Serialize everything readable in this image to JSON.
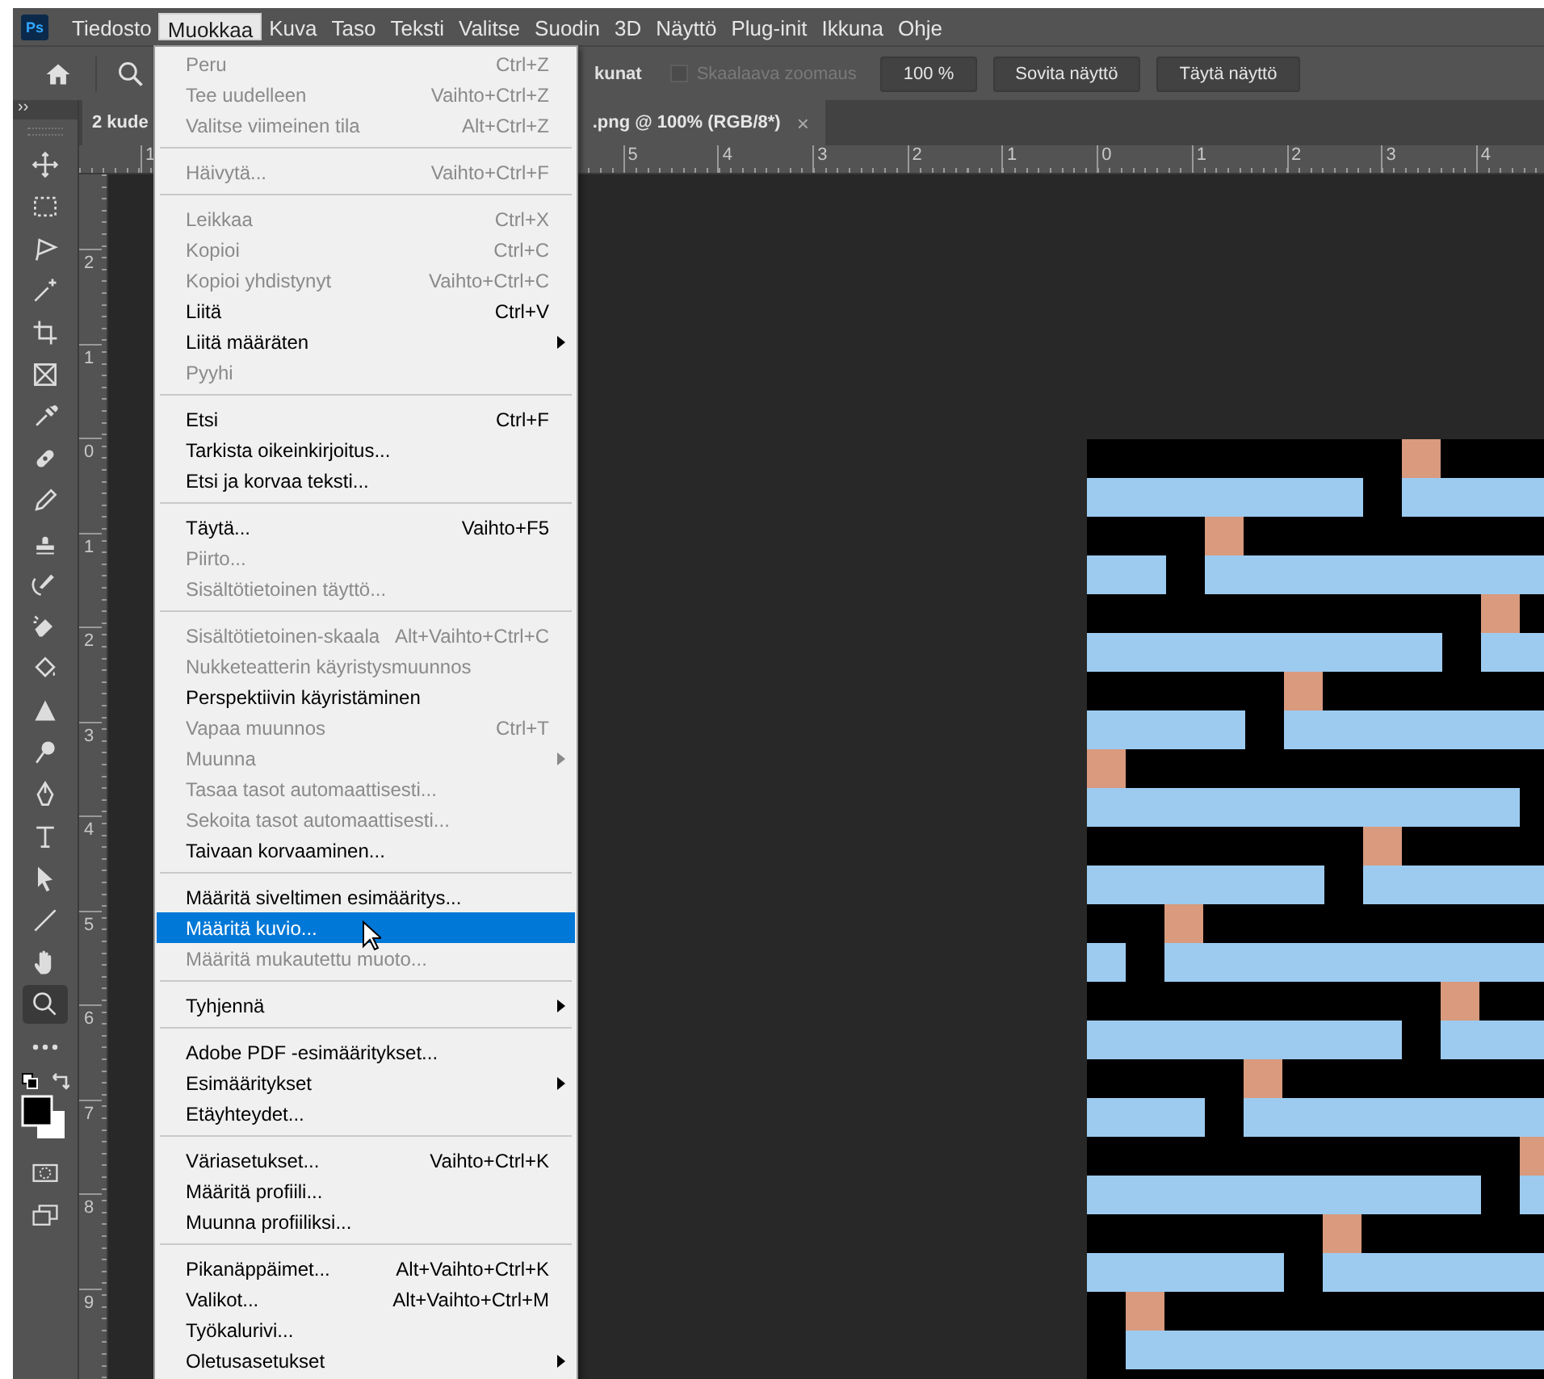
{
  "app_icon": "Ps",
  "menubar": [
    {
      "label": "Tiedosto",
      "selected": false
    },
    {
      "label": "Muokkaa",
      "selected": true
    },
    {
      "label": "Kuva",
      "selected": false
    },
    {
      "label": "Taso",
      "selected": false
    },
    {
      "label": "Teksti",
      "selected": false
    },
    {
      "label": "Valitse",
      "selected": false
    },
    {
      "label": "Suodin",
      "selected": false
    },
    {
      "label": "3D",
      "selected": false
    },
    {
      "label": "Näyttö",
      "selected": false
    },
    {
      "label": "Plug-init",
      "selected": false
    },
    {
      "label": "Ikkuna",
      "selected": false
    },
    {
      "label": "Ohje",
      "selected": false
    }
  ],
  "options_bar": {
    "partial_label": "kunat",
    "checkbox": {
      "label": "Skaalaava zoomaus",
      "checked": false,
      "disabled": true
    },
    "buttons": [
      "100 %",
      "Sovita näyttö",
      "Täytä näyttö"
    ]
  },
  "document_tab": {
    "title_start": "2 kude",
    "title_end": ".png @ 100% (RGB/8*)",
    "close": "×"
  },
  "tool_panel": {
    "collapse": "››",
    "tools": [
      {
        "kind": "move",
        "selected": false
      },
      {
        "kind": "marquee",
        "selected": false
      },
      {
        "kind": "lasso",
        "selected": false
      },
      {
        "kind": "wand",
        "selected": false
      },
      {
        "kind": "crop",
        "selected": false
      },
      {
        "kind": "frame",
        "selected": false
      },
      {
        "kind": "eyedropper",
        "selected": false
      },
      {
        "kind": "bandage",
        "selected": false
      },
      {
        "kind": "pencil",
        "selected": false
      },
      {
        "kind": "stamp",
        "selected": false
      },
      {
        "kind": "history",
        "selected": false
      },
      {
        "kind": "eraser",
        "selected": false
      },
      {
        "kind": "bucket",
        "selected": false
      },
      {
        "kind": "triangle",
        "selected": false
      },
      {
        "kind": "dodge",
        "selected": false
      },
      {
        "kind": "pen",
        "selected": false
      },
      {
        "kind": "text",
        "selected": false
      },
      {
        "kind": "arrow",
        "selected": false
      },
      {
        "kind": "line",
        "selected": false
      },
      {
        "kind": "hand",
        "selected": false
      },
      {
        "kind": "zoom",
        "selected": true
      },
      {
        "kind": "more",
        "selected": false
      }
    ]
  },
  "horizontal_ruler": {
    "labels_before_menu": [
      "1"
    ],
    "labels_after_menu": [
      "5",
      "4",
      "3",
      "2",
      "1",
      "0",
      "1",
      "2",
      "3",
      "4"
    ]
  },
  "vertical_ruler": {
    "labels": [
      "2",
      "1",
      "0",
      "1",
      "2",
      "3",
      "4",
      "5",
      "6",
      "7",
      "8",
      "9"
    ]
  },
  "edit_menu": {
    "items": [
      {
        "kind": "item",
        "label": "Peru",
        "shortcut": "Ctrl+Z",
        "disabled": true,
        "submenu": false,
        "selected": false
      },
      {
        "kind": "item",
        "label": "Tee uudelleen",
        "shortcut": "Vaihto+Ctrl+Z",
        "disabled": true,
        "submenu": false,
        "selected": false
      },
      {
        "kind": "item",
        "label": "Valitse viimeinen tila",
        "shortcut": "Alt+Ctrl+Z",
        "disabled": true,
        "submenu": false,
        "selected": false
      },
      {
        "kind": "separator"
      },
      {
        "kind": "item",
        "label": "Häivytä...",
        "shortcut": "Vaihto+Ctrl+F",
        "disabled": true,
        "submenu": false,
        "selected": false
      },
      {
        "kind": "separator"
      },
      {
        "kind": "item",
        "label": "Leikkaa",
        "shortcut": "Ctrl+X",
        "disabled": true,
        "submenu": false,
        "selected": false
      },
      {
        "kind": "item",
        "label": "Kopioi",
        "shortcut": "Ctrl+C",
        "disabled": true,
        "submenu": false,
        "selected": false
      },
      {
        "kind": "item",
        "label": "Kopioi yhdistynyt",
        "shortcut": "Vaihto+Ctrl+C",
        "disabled": true,
        "submenu": false,
        "selected": false
      },
      {
        "kind": "item",
        "label": "Liitä",
        "shortcut": "Ctrl+V",
        "disabled": false,
        "submenu": false,
        "selected": false
      },
      {
        "kind": "item",
        "label": "Liitä määräten",
        "disabled": false,
        "submenu": true,
        "selected": false
      },
      {
        "kind": "item",
        "label": "Pyyhi",
        "disabled": true,
        "submenu": false,
        "selected": false
      },
      {
        "kind": "separator"
      },
      {
        "kind": "item",
        "label": "Etsi",
        "shortcut": "Ctrl+F",
        "disabled": false,
        "submenu": false,
        "selected": false
      },
      {
        "kind": "item",
        "label": "Tarkista oikeinkirjoitus...",
        "disabled": false,
        "submenu": false,
        "selected": false
      },
      {
        "kind": "item",
        "label": "Etsi ja korvaa teksti...",
        "disabled": false,
        "submenu": false,
        "selected": false
      },
      {
        "kind": "separator"
      },
      {
        "kind": "item",
        "label": "Täytä...",
        "shortcut": "Vaihto+F5",
        "disabled": false,
        "submenu": false,
        "selected": false
      },
      {
        "kind": "item",
        "label": "Piirto...",
        "disabled": true,
        "submenu": false,
        "selected": false
      },
      {
        "kind": "item",
        "label": "Sisältötietoinen täyttö...",
        "disabled": true,
        "submenu": false,
        "selected": false
      },
      {
        "kind": "separator"
      },
      {
        "kind": "item",
        "label": "Sisältötietoinen-skaala",
        "shortcut": "Alt+Vaihto+Ctrl+C",
        "disabled": true,
        "submenu": false,
        "selected": false
      },
      {
        "kind": "item",
        "label": "Nukketeatterin käyristysmuunnos",
        "disabled": true,
        "submenu": false,
        "selected": false
      },
      {
        "kind": "item",
        "label": "Perspektiivin käyristäminen",
        "disabled": false,
        "submenu": false,
        "selected": false
      },
      {
        "kind": "item",
        "label": "Vapaa muunnos",
        "shortcut": "Ctrl+T",
        "disabled": true,
        "submenu": false,
        "selected": false
      },
      {
        "kind": "item",
        "label": "Muunna",
        "disabled": true,
        "submenu": true,
        "selected": false
      },
      {
        "kind": "item",
        "label": "Tasaa tasot automaattisesti...",
        "disabled": true,
        "submenu": false,
        "selected": false
      },
      {
        "kind": "item",
        "label": "Sekoita tasot automaattisesti...",
        "disabled": true,
        "submenu": false,
        "selected": false
      },
      {
        "kind": "item",
        "label": "Taivaan korvaaminen...",
        "disabled": false,
        "submenu": false,
        "selected": false
      },
      {
        "kind": "separator"
      },
      {
        "kind": "item",
        "label": "Määritä siveltimen esimääritys...",
        "disabled": false,
        "submenu": false,
        "selected": false
      },
      {
        "kind": "item",
        "label": "Määritä kuvio...",
        "disabled": false,
        "submenu": false,
        "selected": true
      },
      {
        "kind": "item",
        "label": "Määritä mukautettu muoto...",
        "disabled": true,
        "submenu": false,
        "selected": false
      },
      {
        "kind": "separator"
      },
      {
        "kind": "item",
        "label": "Tyhjennä",
        "disabled": false,
        "submenu": true,
        "selected": false
      },
      {
        "kind": "separator"
      },
      {
        "kind": "item",
        "label": "Adobe PDF -esimääritykset...",
        "disabled": false,
        "submenu": false,
        "selected": false
      },
      {
        "kind": "item",
        "label": "Esimääritykset",
        "disabled": false,
        "submenu": true,
        "selected": false
      },
      {
        "kind": "item",
        "label": "Etäyhteydet...",
        "disabled": false,
        "submenu": false,
        "selected": false
      },
      {
        "kind": "separator"
      },
      {
        "kind": "item",
        "label": "Väriasetukset...",
        "shortcut": "Vaihto+Ctrl+K",
        "disabled": false,
        "submenu": false,
        "selected": false
      },
      {
        "kind": "item",
        "label": "Määritä profiili...",
        "disabled": false,
        "submenu": false,
        "selected": false
      },
      {
        "kind": "item",
        "label": "Muunna profiiliksi...",
        "disabled": false,
        "submenu": false,
        "selected": false
      },
      {
        "kind": "separator"
      },
      {
        "kind": "item",
        "label": "Pikanäppäimet...",
        "shortcut": "Alt+Vaihto+Ctrl+K",
        "disabled": false,
        "submenu": false,
        "selected": false
      },
      {
        "kind": "item",
        "label": "Valikot...",
        "shortcut": "Alt+Vaihto+Ctrl+M",
        "disabled": false,
        "submenu": false,
        "selected": false
      },
      {
        "kind": "item",
        "label": "Työkalurivi...",
        "disabled": false,
        "submenu": false,
        "selected": false
      },
      {
        "kind": "item",
        "label": "Oletusasetukset",
        "disabled": false,
        "submenu": true,
        "selected": false
      }
    ]
  }
}
